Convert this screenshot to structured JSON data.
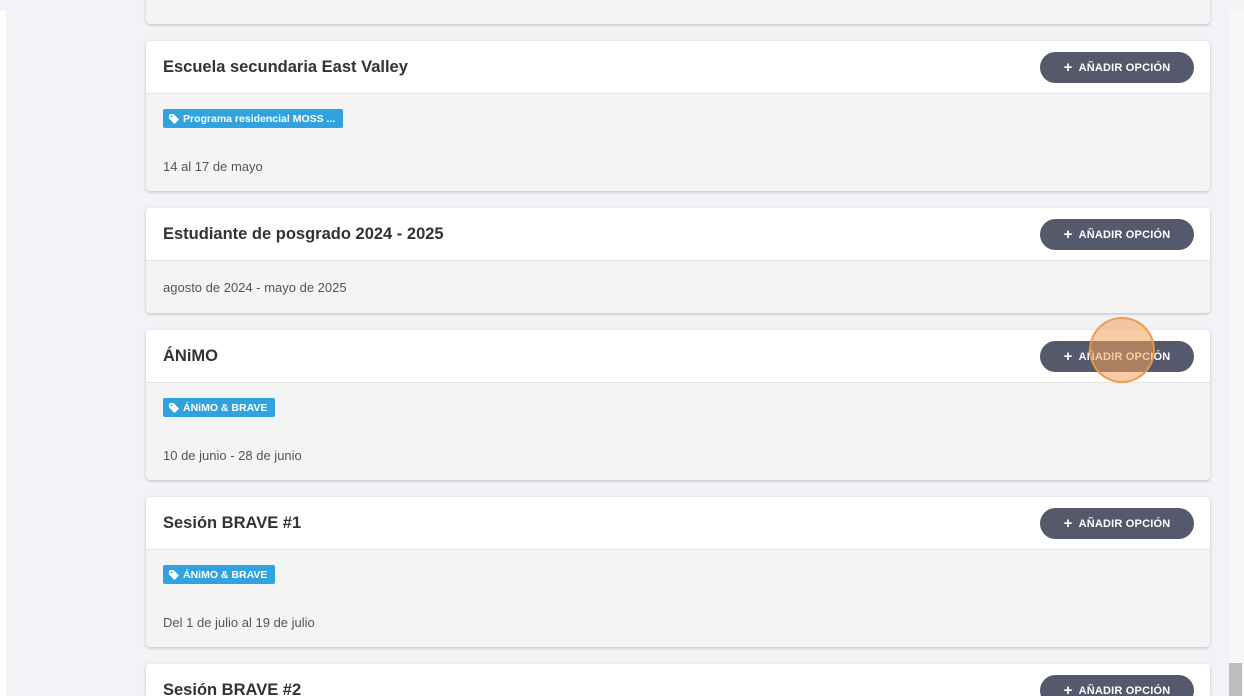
{
  "cards": [
    {
      "title": "Escuela secundaria East Valley",
      "button_label": "AÑADIR OPCIÓN",
      "tag": "Programa residencial MOSS ...",
      "date": "14 al 17 de mayo"
    },
    {
      "title": "Estudiante de posgrado 2024 - 2025",
      "button_label": "AÑADIR OPCIÓN",
      "date": "agosto de 2024 - mayo de 2025"
    },
    {
      "title": "ÁNiMO",
      "button_label": "AÑADIR OPCIÓN",
      "tag": "ÁNiMO & BRAVE",
      "date": "10 de junio - 28 de junio"
    },
    {
      "title": "Sesión BRAVE #1",
      "button_label": "AÑADIR OPCIÓN",
      "tag": "ÁNiMO & BRAVE",
      "date": "Del 1 de julio al 19 de julio"
    },
    {
      "title": "Sesión BRAVE #2",
      "button_label": "AÑADIR OPCIÓN"
    }
  ],
  "colors": {
    "button_bg": "#545a6b",
    "tag_bg": "#31a2e0",
    "click_marker": "#f0a05a"
  },
  "icons": {
    "button": "plus-icon",
    "tag": "tag-icon"
  }
}
